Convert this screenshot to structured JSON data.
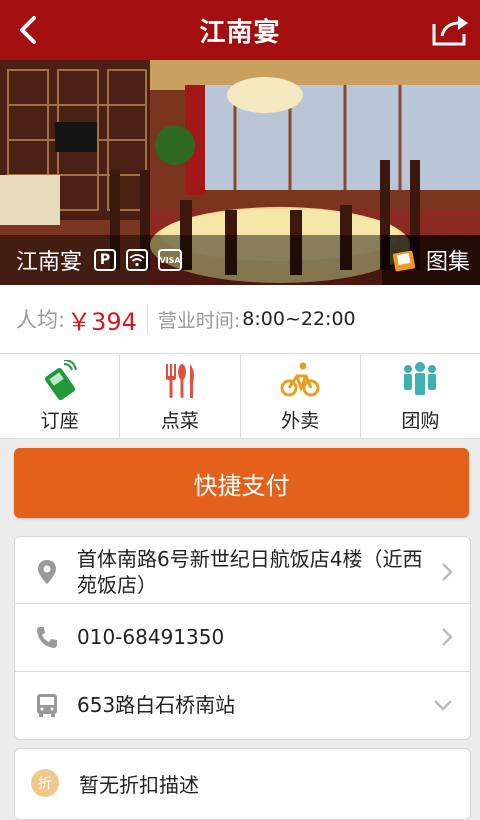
{
  "header": {
    "title": "江南宴"
  },
  "hero": {
    "name": "江南宴",
    "amenities": [
      "P",
      "wifi",
      "VISA"
    ],
    "gallery_label": "图集"
  },
  "info": {
    "avg_label": "人均:",
    "avg_price": "￥394",
    "hours_label": "营业时间:",
    "hours_value": "8:00~22:00"
  },
  "actions": [
    {
      "label": "订座",
      "icon": "phone-icon",
      "color": "#1e9a3a"
    },
    {
      "label": "点菜",
      "icon": "cutlery-icon",
      "color": "#e05040"
    },
    {
      "label": "外卖",
      "icon": "bicycle-icon",
      "color": "#e6a020"
    },
    {
      "label": "团购",
      "icon": "group-icon",
      "color": "#3fb0b0"
    }
  ],
  "pay": {
    "label": "快捷支付"
  },
  "details": {
    "address": "首体南路6号新世纪日航饭店4楼（近西苑饭店）",
    "phone": "010-68491350",
    "bus": "653路白石桥南站"
  },
  "discount": {
    "badge": "折",
    "text": "暂无折扣描述"
  },
  "colors": {
    "brand": "#a30f0f",
    "pay": "#e4611c",
    "price": "#d71818"
  }
}
